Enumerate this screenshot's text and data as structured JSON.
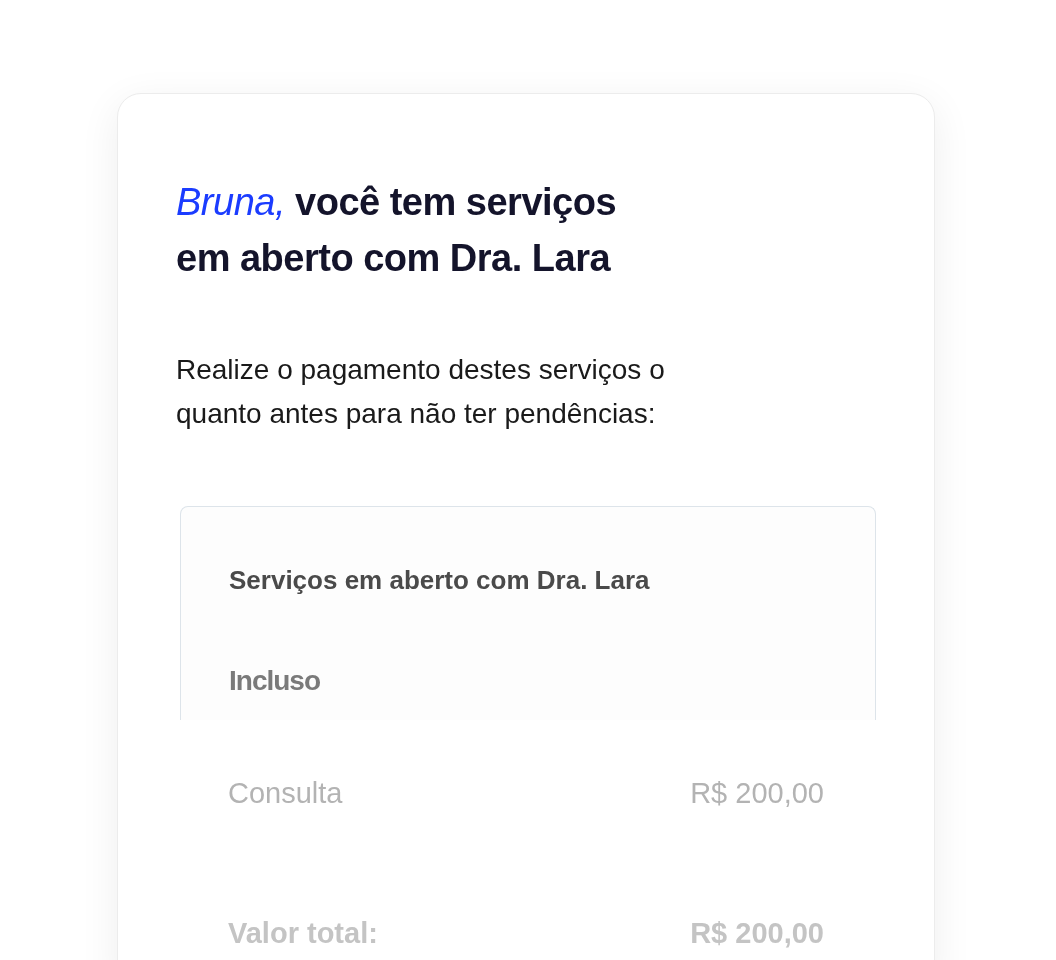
{
  "heading": {
    "name": "Bruna,",
    "rest": "você tem serviços em aberto com Dra. Lara"
  },
  "message": "Realize o pagamento destes serviços o quanto antes para não ter pendências:",
  "services": {
    "title": "Serviços em aberto com Dra. Lara",
    "section": "Incluso",
    "items": [
      {
        "label": "Consulta",
        "amount": "R$ 200,00"
      }
    ],
    "total": {
      "label": "Valor total:",
      "amount": "R$ 200,00"
    }
  }
}
